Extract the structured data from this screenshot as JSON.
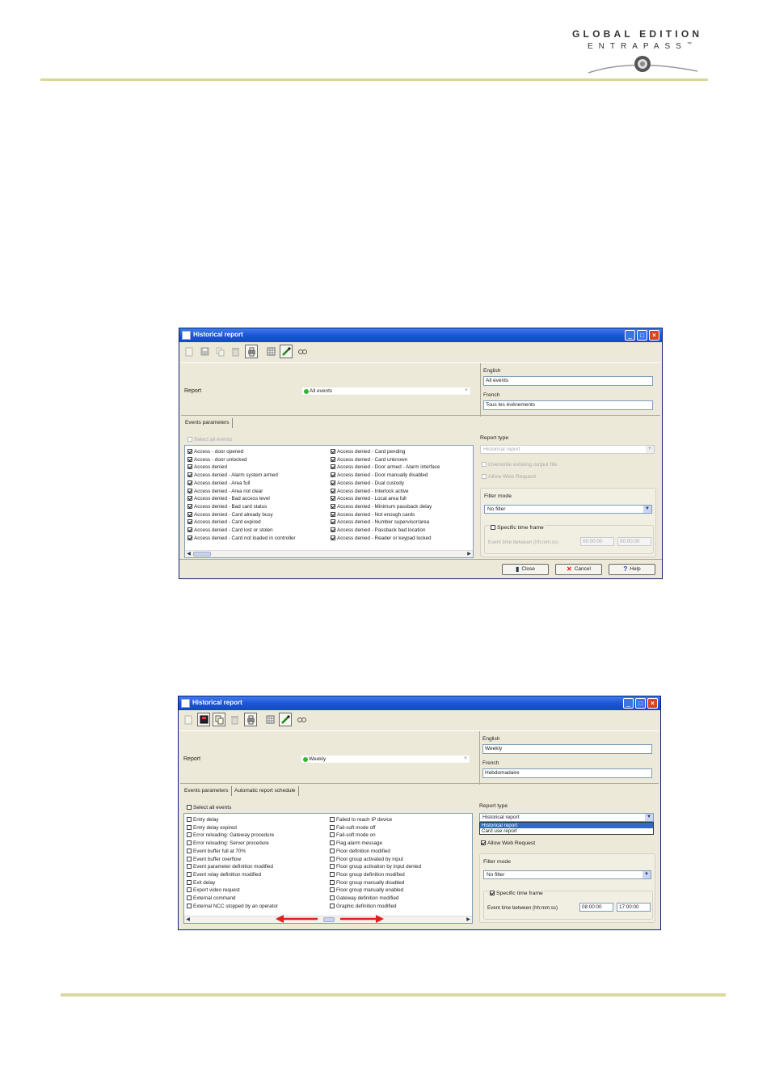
{
  "logo": {
    "line1": "GLOBAL EDITION",
    "line2": "ENTRAPASS",
    "trademark": "™"
  },
  "window1": {
    "title": "Historical report",
    "report_label": "Report",
    "report_value": "All events",
    "english_label": "English",
    "english_value": "All events",
    "french_label": "French",
    "french_value": "Tous les événements",
    "tabs": [
      "Events parameters"
    ],
    "select_all": "Select all events",
    "events_col1": [
      "Access - door opened",
      "Access - door unlocked",
      "Access denied",
      "Access denied - Alarm system armed",
      "Access denied - Area full",
      "Access denied - Area not clear",
      "Access denied - Bad access level",
      "Access denied - Bad card status",
      "Access denied - Card already busy",
      "Access denied - Card expired",
      "Access denied - Card lost or stolen",
      "Access denied - Card not loaded in controller"
    ],
    "events_col2": [
      "Access denied - Card pending",
      "Access denied - Card unknown",
      "Access denied - Door armed - Alarm interface",
      "Access denied - Door manually disabled",
      "Access denied - Dual custody",
      "Access denied - Interlock active",
      "Access denied - Local area full",
      "Access denied - Minimum passback delay",
      "Access denied - Not enough cards",
      "Access denied - Number supervisor/area",
      "Access denied - Passback bad location",
      "Access denied - Reader or keypad locked"
    ],
    "report_type_label": "Report type",
    "report_type_value": "Historical report",
    "overwrite_label": "Overwrite existing output file",
    "allow_web_label": "Allow Web Request",
    "filter_mode_label": "Filter mode",
    "filter_mode_value": "No filter",
    "specific_time_label": "Specific time frame",
    "event_time_label": "Event time between (hh:mm:ss)",
    "time_from": "00:00:00",
    "time_to": "00:00:00",
    "close_label": "Close",
    "cancel_label": "Cancel",
    "help_label": "Help"
  },
  "window2": {
    "title": "Historical report",
    "report_label": "Report",
    "report_value": "Weekly",
    "english_label": "English",
    "english_value": "Weekly",
    "french_label": "French",
    "french_value": "Hebdomadaire",
    "tabs": [
      "Events parameters",
      "Automatic report schedule"
    ],
    "select_all": "Select all events",
    "events_col1": [
      "Entry delay",
      "Entry delay expired",
      "Error reloading: Gateway procedure",
      "Error reloading: Server procedure",
      "Event buffer full at 70%",
      "Event buffer overflow",
      "Event parameter definition modified",
      "Event relay definition modified",
      "Exit delay",
      "Export video request",
      "External command",
      "External NCC stopped by an operator"
    ],
    "events_col2": [
      "Failed to reach IP device",
      "Fail-soft mode off",
      "Fail-soft mode on",
      "Flag alarm message",
      "Floor definition modified",
      "Floor group activated by input",
      "Floor group activation by input denied",
      "Floor group definition modified",
      "Floor group manually disabled",
      "Floor group manually enabled",
      "Gateway definition modified",
      "Graphic definition modified"
    ],
    "report_type_label": "Report type",
    "report_type_value": "Historical report",
    "report_type_options": [
      "Historical report",
      "Card use report"
    ],
    "allow_web_label": "Allow Web Request",
    "filter_mode_label": "Filter mode",
    "filter_mode_value": "No filter",
    "specific_time_label": "Specific time frame",
    "event_time_label": "Event time between (hh:mm:ss)",
    "time_from": "08:00:00",
    "time_to": "17:00:00"
  },
  "colors": {
    "titlebar": "#1c55d8",
    "window_bg": "#ece9d8",
    "rule": "#d9d69a",
    "arrow": "#e02020"
  }
}
